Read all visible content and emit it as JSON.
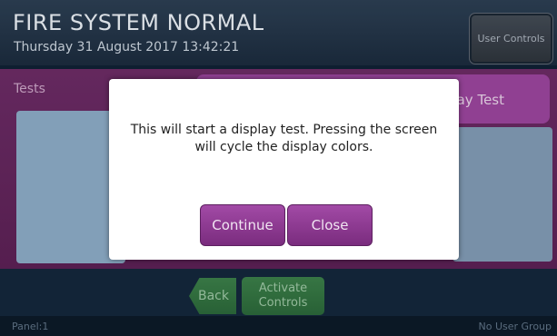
{
  "header": {
    "status_title": "FIRE SYSTEM NORMAL",
    "datetime": "Thursday 31 August 2017 13:42:21",
    "user_controls_label": "User Controls"
  },
  "content": {
    "section_label": "Tests",
    "active_test_label": "Display Test"
  },
  "dialog": {
    "message": "This will start a display test. Pressing the screen will cycle the display colors.",
    "continue_label": "Continue",
    "close_label": "Close"
  },
  "footer": {
    "back_label": "Back",
    "activate_label_line1": "Activate",
    "activate_label_line2": "Controls",
    "panel_label": "Panel:1",
    "user_group_label": "No User Group"
  },
  "colors": {
    "header_bg": "#1b2b3d",
    "content_purple": "#5a2054",
    "tab_purple": "#98449a",
    "dialog_button_purple": "#8a388e",
    "nav_green": "#2b6639",
    "dialog_bg": "#ffffff"
  }
}
